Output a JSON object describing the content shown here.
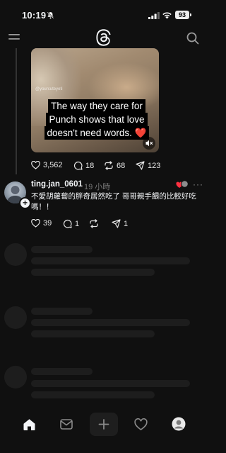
{
  "status_bar": {
    "time": "10:19",
    "battery": "93",
    "icons": [
      "bell-slash-icon",
      "signal-icon",
      "wifi-icon",
      "battery-icon"
    ]
  },
  "header": {
    "left_icon": "menu-icon",
    "logo": "threads-logo",
    "right_icon": "search-icon"
  },
  "post": {
    "media": {
      "watermark": "@yourcuteyeti",
      "caption_lines": [
        "The way they care for",
        "Punch shows that love",
        "doesn't need words. ❤️"
      ],
      "mute_icon": "speaker-muted-icon"
    },
    "actions": {
      "likes": "3,562",
      "comments": "18",
      "reposts": "68",
      "shares": "123"
    }
  },
  "reply": {
    "username": "ting.jan_0601",
    "time": "19 小時",
    "text": "不愛胡蘿蔔的胖奇居然吃了 哥哥親手餵的比較好吃嗎！！",
    "more": "···",
    "actions": {
      "likes": "39",
      "comments": "1",
      "reposts": "",
      "shares": "1"
    }
  },
  "bottom_nav": {
    "items": [
      "home-icon",
      "inbox-icon",
      "compose-icon",
      "activity-icon",
      "profile-icon"
    ],
    "active": "home-icon"
  },
  "colors": {
    "background": "#101010",
    "text": "#f3f5f7",
    "muted": "#777777",
    "skeleton": "#1d1d1d",
    "heart": "#ff3040"
  }
}
